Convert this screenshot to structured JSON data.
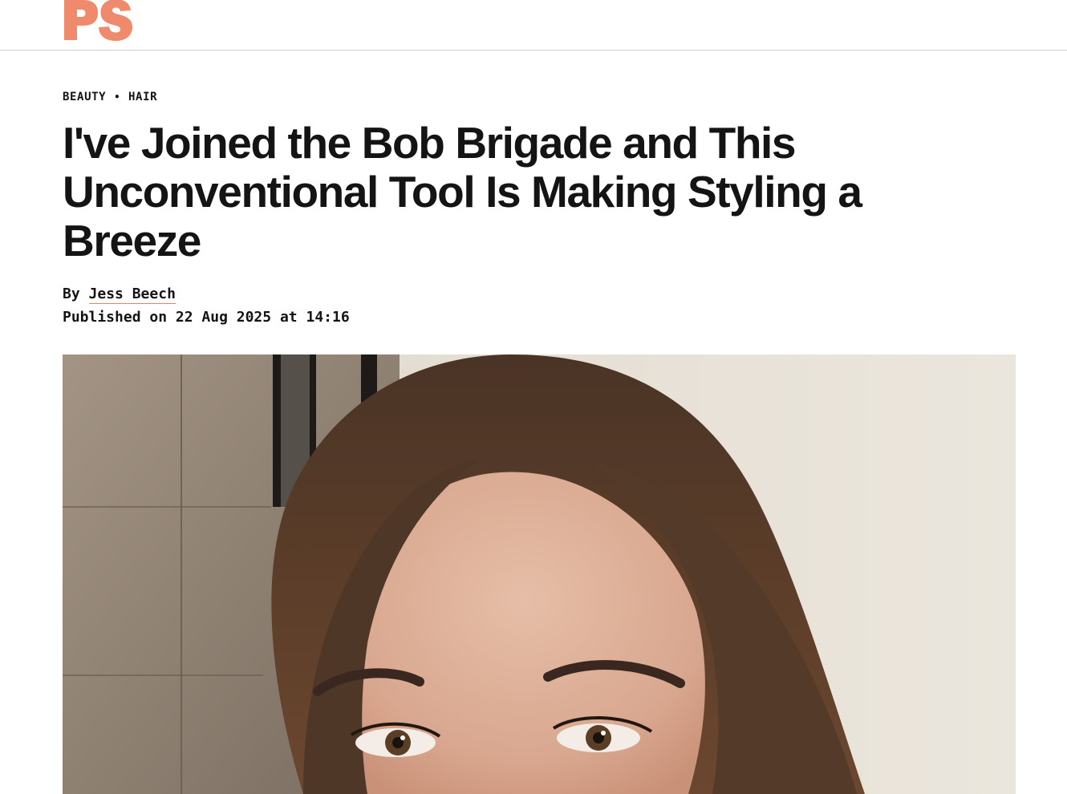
{
  "site": {
    "logo_text": "PS",
    "brand_color": "#f08a6c"
  },
  "breadcrumb": {
    "category": "BEAUTY",
    "separator": "•",
    "subcategory": "HAIR"
  },
  "article": {
    "title": "I've Joined the Bob Brigade and This Unconventional Tool Is Making Styling a Breeze",
    "byline_prefix": "By",
    "author": "Jess Beech",
    "published_label": "Published on",
    "published_date": "22 Aug 2025",
    "published_at_word": "at",
    "published_time": "14:16"
  },
  "hero_image": {
    "subject": "close-up selfie of a woman with long brown hair, eyes visible, tiled wall and pale wall behind"
  },
  "colors": {
    "text": "#141414",
    "author_underline": "#e8806a",
    "header_border": "#d0d0d0"
  }
}
